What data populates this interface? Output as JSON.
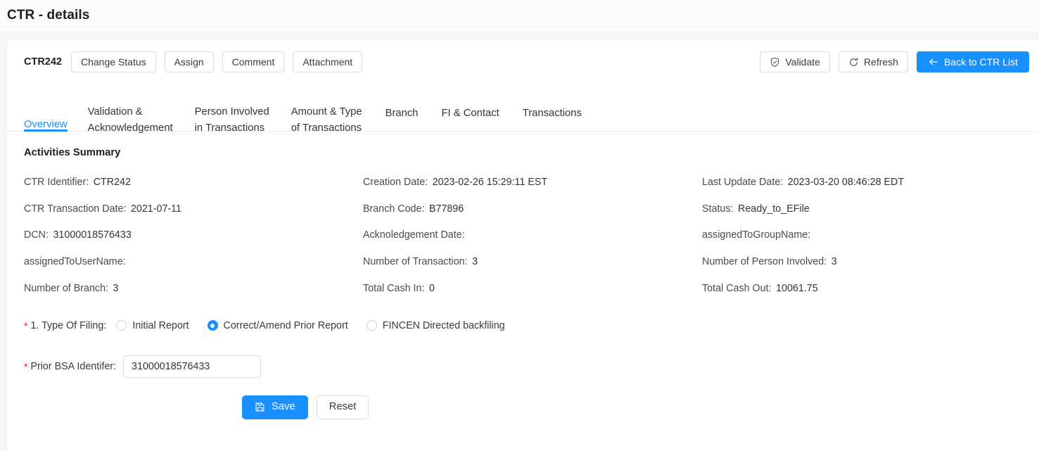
{
  "page": {
    "title": "CTR - details"
  },
  "action_bar": {
    "record_id": "CTR242",
    "left_buttons": [
      {
        "label": "Change Status",
        "name": "change-status-button"
      },
      {
        "label": "Assign",
        "name": "assign-button"
      },
      {
        "label": "Comment",
        "name": "comment-button"
      },
      {
        "label": "Attachment",
        "name": "attachment-button"
      }
    ],
    "right_buttons": [
      {
        "label": "Validate",
        "icon": "shield-check-icon",
        "name": "validate-button"
      },
      {
        "label": "Refresh",
        "icon": "refresh-icon",
        "name": "refresh-button"
      },
      {
        "label": "Back to CTR List",
        "icon": "arrow-left-icon",
        "name": "back-to-ctr-list-button"
      }
    ]
  },
  "tabs": {
    "active": "Overview",
    "items": [
      {
        "label": "Overview"
      },
      {
        "label": "Validation &\nAcknowledgement"
      },
      {
        "label": "Person Involved\nin Transactions"
      },
      {
        "label": "Amount & Type\nof Transactions"
      },
      {
        "label": "Branch"
      },
      {
        "label": "FI & Contact"
      },
      {
        "label": "Transactions"
      }
    ]
  },
  "summary": {
    "heading": "Activities Summary",
    "fields": [
      {
        "label": "CTR Identifier",
        "value": "CTR242"
      },
      {
        "label": "Creation Date",
        "value": "2023-02-26 15:29:11 EST"
      },
      {
        "label": "Last Update Date",
        "value": "2023-03-20 08:46:28 EDT"
      },
      {
        "label": "CTR Transaction Date",
        "value": "2021-07-11"
      },
      {
        "label": "Branch Code",
        "value": "B77896"
      },
      {
        "label": "Status",
        "value": "Ready_to_EFile"
      },
      {
        "label": "DCN",
        "value": "31000018576433"
      },
      {
        "label": "Acknoledgement Date",
        "value": ""
      },
      {
        "label": "assignedToGroupName",
        "value": ""
      },
      {
        "label": "assignedToUserName",
        "value": ""
      },
      {
        "label": "Number of Transaction",
        "value": "3"
      },
      {
        "label": "Number of Person Involved",
        "value": "3"
      },
      {
        "label": "Number of Branch",
        "value": "3"
      },
      {
        "label": "Total Cash In",
        "value": "0"
      },
      {
        "label": "Total Cash Out",
        "value": "10061.75"
      }
    ]
  },
  "form": {
    "required_mark": "*",
    "type_of_filing": {
      "label": "1. Type Of Filing:",
      "options": [
        {
          "label": "Initial Report",
          "checked": false
        },
        {
          "label": "Correct/Amend Prior Report",
          "checked": true
        },
        {
          "label": "FINCEN Directed backfiling",
          "checked": false
        }
      ]
    },
    "prior_bsa": {
      "label": "Prior BSA Identifer:",
      "value": "31000018576433",
      "placeholder": ""
    },
    "save_label": "Save",
    "save_icon": "save-floppy-icon",
    "reset_label": "Reset"
  },
  "colors": {
    "primary": "#1890ff",
    "required": "#f5222d",
    "page_bg": "#f5f6f8",
    "card_bg": "#ffffff",
    "border": "#d9dbe0"
  }
}
